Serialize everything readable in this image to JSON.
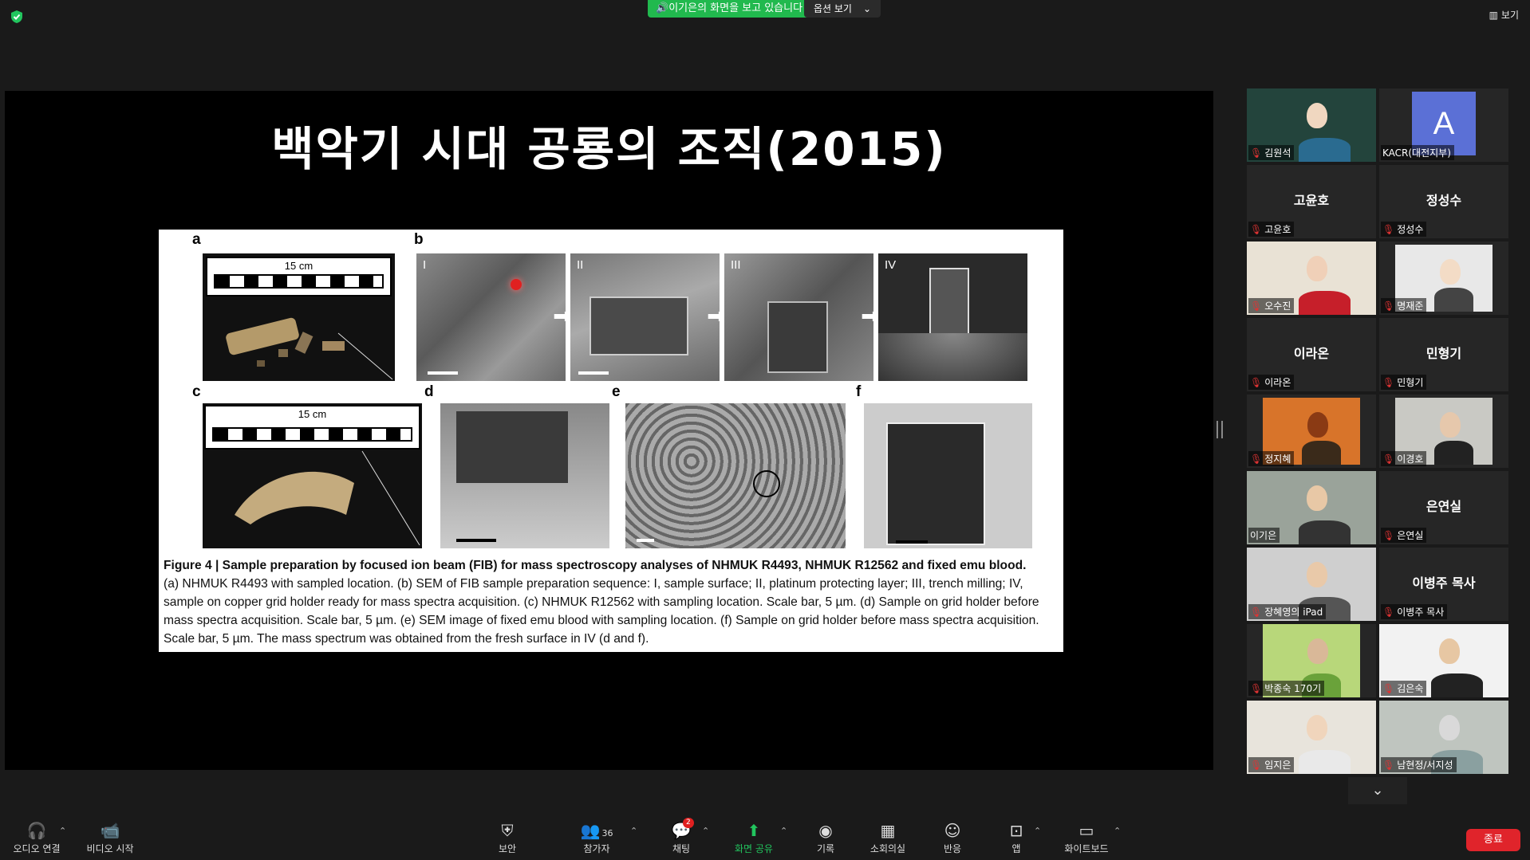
{
  "top": {
    "share_banner": "이기은의 화면을 보고 있습니다",
    "view_options": "옵션 보기",
    "view_button": "보기"
  },
  "slide": {
    "title": "백악기 시대 공룡의 조직(2015)",
    "figure": {
      "letters": {
        "a": "a",
        "b": "b",
        "c": "c",
        "d": "d",
        "e": "e",
        "f": "f"
      },
      "romans": [
        "I",
        "II",
        "III",
        "IV"
      ],
      "ruler_label": "15 cm",
      "caption_title": "Figure 4 | Sample preparation by focused ion beam (FIB) for mass spectroscopy analyses of NHMUK R4493, NHMUK R12562 and fixed emu blood.",
      "caption_body": "(a) NHMUK R4493 with sampled location. (b) SEM of FIB sample preparation sequence: I, sample surface; II, platinum protecting layer; III, trench milling; IV, sample on copper grid holder ready for mass spectra acquisition. (c) NHMUK R12562 with sampling location. Scale bar, 5 µm. (d) Sample on grid holder before mass spectra acquisition. Scale bar, 5 µm. (e) SEM image of fixed emu blood with sampling location. (f) Sample on grid holder before mass spectra acquisition. Scale bar, 5 µm. The mass spectrum was obtained from the fresh surface in IV (d and f)."
    }
  },
  "participants": [
    {
      "name": "김원석",
      "big": "",
      "video": true
    },
    {
      "name": "KACR(대전지부)",
      "big": "A",
      "video": false
    },
    {
      "name": "고윤호",
      "big": "고윤호",
      "video": false
    },
    {
      "name": "정성수",
      "big": "정성수",
      "video": false
    },
    {
      "name": "오수진",
      "big": "",
      "video": true
    },
    {
      "name": "명재준",
      "big": "",
      "video": true
    },
    {
      "name": "이라온",
      "big": "이라온",
      "video": false
    },
    {
      "name": "민형기",
      "big": "민형기",
      "video": false
    },
    {
      "name": "정지혜",
      "big": "",
      "video": true
    },
    {
      "name": "이경호",
      "big": "",
      "video": true
    },
    {
      "name": "이기은",
      "big": "",
      "video": true
    },
    {
      "name": "은연실",
      "big": "은연실",
      "video": false
    },
    {
      "name": "장혜영의 iPad",
      "big": "",
      "video": true
    },
    {
      "name": "이병주 목사",
      "big": "이병주 목사",
      "video": false
    },
    {
      "name": "박종숙 170기",
      "big": "",
      "video": true
    },
    {
      "name": "김은숙",
      "big": "",
      "video": true
    },
    {
      "name": "임지은",
      "big": "",
      "video": true
    },
    {
      "name": "남현정/서지성",
      "big": "",
      "video": true
    }
  ],
  "toolbar": {
    "audio": "오디오 연결",
    "video": "비디오 시작",
    "security": "보안",
    "participants": "참가자",
    "participants_count": "36",
    "chat": "채팅",
    "chat_badge": "2",
    "share": "화면 공유",
    "record": "기록",
    "breakout": "소회의실",
    "reactions": "반응",
    "apps": "앱",
    "whiteboard": "화이트보드",
    "end": "종료"
  },
  "colors": {
    "share_green": "#21b94e",
    "end_red": "#e0242b",
    "active_speaker": "#c8e35a",
    "muted": "#e03333"
  }
}
